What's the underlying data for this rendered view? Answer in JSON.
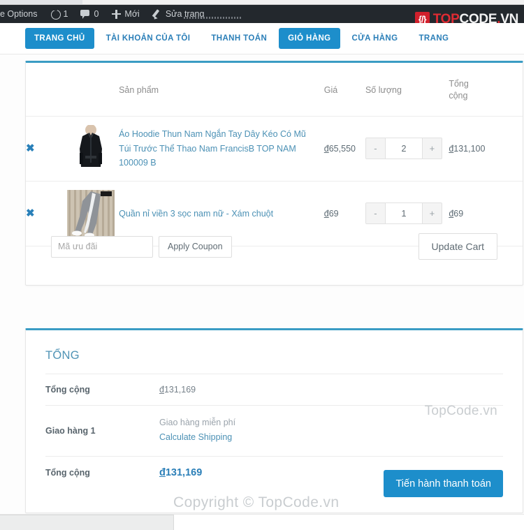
{
  "adminbar": {
    "options_label": "e Options",
    "updates_icon": "update-icon",
    "updates_count": "1",
    "comments_icon": "comment-icon",
    "comments_count": "0",
    "new_icon": "plus-icon",
    "new_label": "Mới",
    "edit_icon": "pencil-icon",
    "edit_label": "Sửa trang"
  },
  "logo": {
    "mark_glyph": "{/}",
    "top": "TOP",
    "code": "CODE",
    "dot": ".",
    "vn": "VN"
  },
  "nav": {
    "items": [
      {
        "label": "TRANG CHỦ",
        "active": true
      },
      {
        "label": "TÀI KHOẢN CỦA TÔI",
        "active": false
      },
      {
        "label": "THANH TOÁN",
        "active": false
      },
      {
        "label": "GIỎ HÀNG",
        "active": true
      },
      {
        "label": "CỬA HÀNG",
        "active": false
      },
      {
        "label": "TRANG",
        "active": false
      }
    ]
  },
  "cart": {
    "headers": {
      "remove": "",
      "thumb": "",
      "product": "Sản phẩm",
      "price": "Giá",
      "quantity": "Số lượng",
      "subtotal_line1": "Tổng",
      "subtotal_line2": "cộng"
    },
    "remove_glyph": "✖",
    "minus_label": "-",
    "plus_label": "+",
    "rows": [
      {
        "name": "Áo Hoodie Thun Nam Ngắn Tay Dây Kéo Có Mũ Túi Trước Thể Thao Nam FrancisB TOP NAM 100009 B",
        "price": "đ65,550",
        "price_symbol": "đ",
        "price_amount": "65,550",
        "quantity": "2",
        "subtotal": "đ131,100",
        "subtotal_symbol": "đ",
        "subtotal_amount": "131,100",
        "thumb_alt": "black-shirt-thumbnail"
      },
      {
        "name": "Quần nỉ viền 3 sọc nam nữ - Xám chuột",
        "price": "đ69",
        "price_symbol": "đ",
        "price_amount": "69",
        "quantity": "1",
        "subtotal": "đ69",
        "subtotal_symbol": "đ",
        "subtotal_amount": "69",
        "thumb_alt": "gray-striped-pants-thumbnail"
      }
    ],
    "coupon_placeholder": "Mã ưu đãi",
    "coupon_value": "",
    "apply_coupon_label": "Apply Coupon",
    "update_cart_label": "Update Cart"
  },
  "totals": {
    "title": "TỔNG",
    "subtotal_label": "Tổng cộng",
    "subtotal_value": "đ131,169",
    "subtotal_symbol": "đ",
    "subtotal_amount": "131,169",
    "shipping_label": "Giao hàng 1",
    "shipping_method": "Giao hàng miễn phí",
    "calculate_shipping_label": "Calculate Shipping",
    "grand_label": "Tổng cộng",
    "grand_value": "đ131,169",
    "grand_symbol": "đ",
    "grand_amount": "131,169",
    "checkout_label": "Tiến hành thanh toán"
  },
  "watermarks": {
    "totals": "TopCode.vn",
    "footer": "Copyright © TopCode.vn"
  },
  "colors": {
    "accent_blue": "#1d8ecb",
    "card_top_border": "#3a9cc4",
    "link_blue": "#4c91b5",
    "admin_bar": "#23282d",
    "logo_red": "#d1202c"
  }
}
